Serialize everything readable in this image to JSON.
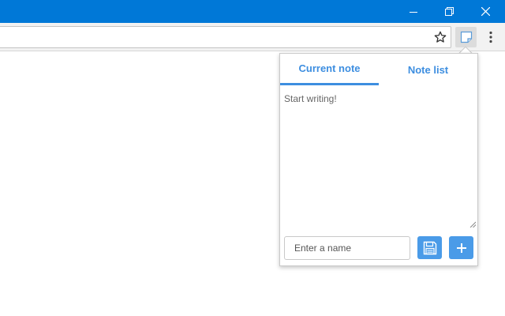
{
  "window": {
    "controls": [
      "minimize-icon",
      "restore-icon",
      "close-icon"
    ],
    "titlebar_color": "#0078d7"
  },
  "toolbar": {
    "omnibox_value": "",
    "icons": [
      "bookmark-star-icon",
      "sticky-note-extension-icon",
      "kebab-menu-icon"
    ]
  },
  "popup": {
    "tabs": [
      {
        "label": "Current note",
        "active": true
      },
      {
        "label": "Note list",
        "active": false
      }
    ],
    "note": {
      "placeholder": "Start writing!",
      "value": ""
    },
    "name_input": {
      "placeholder": "Enter a name",
      "value": ""
    },
    "buttons": [
      "save-icon",
      "plus-icon"
    ],
    "accent_color": "#4a9be8"
  }
}
